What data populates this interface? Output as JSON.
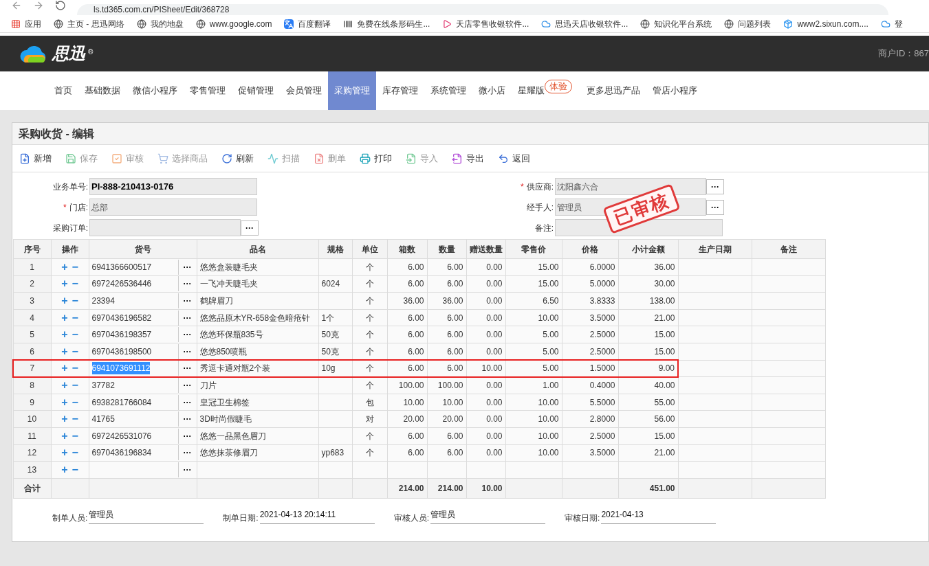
{
  "browser": {
    "url": "ls.td365.com.cn/PISheet/Edit/368728",
    "bookmarks": [
      {
        "label": "应用",
        "kind": "apps"
      },
      {
        "label": "主页 - 思迅网络",
        "kind": "globe"
      },
      {
        "label": "我的地盘",
        "kind": "globe"
      },
      {
        "label": "www.google.com",
        "kind": "globe"
      },
      {
        "label": "百度翻译",
        "kind": "translate"
      },
      {
        "label": "免费在线条形码生...",
        "kind": "barcode"
      },
      {
        "label": "天店零售收银软件...",
        "kind": "play"
      },
      {
        "label": "思迅天店收银软件...",
        "kind": "cloud"
      },
      {
        "label": "知识化平台系统",
        "kind": "globe"
      },
      {
        "label": "问题列表",
        "kind": "globe"
      },
      {
        "label": "www2.sixun.com....",
        "kind": "box"
      },
      {
        "label": "登",
        "kind": "cloud"
      }
    ]
  },
  "header": {
    "logo": "思迅",
    "logo_mark": "®",
    "merchant_id": "商户ID：867"
  },
  "nav": [
    {
      "label": "首页",
      "selected": false
    },
    {
      "label": "基础数据",
      "selected": false
    },
    {
      "label": "微信小程序",
      "selected": false
    },
    {
      "label": "零售管理",
      "selected": false
    },
    {
      "label": "促销管理",
      "selected": false
    },
    {
      "label": "会员管理",
      "selected": false
    },
    {
      "label": "采购管理",
      "selected": true
    },
    {
      "label": "库存管理",
      "selected": false
    },
    {
      "label": "系统管理",
      "selected": false
    },
    {
      "label": "微小店",
      "selected": false
    },
    {
      "label": "星耀版",
      "selected": false,
      "badge": "体验"
    },
    {
      "label": "更多思迅产品",
      "selected": false
    },
    {
      "label": "管店小程序",
      "selected": false
    }
  ],
  "panel_title": "采购收货 - 编辑",
  "toolbar": [
    {
      "label": "新增",
      "kind": "new",
      "disabled": false
    },
    {
      "label": "保存",
      "kind": "save",
      "disabled": true
    },
    {
      "label": "审核",
      "kind": "approve",
      "disabled": true
    },
    {
      "label": "选择商品",
      "kind": "cart",
      "disabled": true
    },
    {
      "label": "刷新",
      "kind": "refresh",
      "disabled": false
    },
    {
      "label": "扫描",
      "kind": "scan",
      "disabled": true
    },
    {
      "label": "删单",
      "kind": "delete",
      "disabled": true
    },
    {
      "label": "打印",
      "kind": "print",
      "disabled": false
    },
    {
      "label": "导入",
      "kind": "import",
      "disabled": true
    },
    {
      "label": "导出",
      "kind": "export",
      "disabled": false
    },
    {
      "label": "返回",
      "kind": "back",
      "disabled": false
    }
  ],
  "required_mark": "*",
  "form_left": [
    {
      "label": "业务单号:",
      "value": "PI-888-210413-0176",
      "required": false,
      "lookup": false,
      "bold": true
    },
    {
      "label": "门店:",
      "value": "总部",
      "required": true,
      "lookup": false,
      "bold": false
    },
    {
      "label": "采购订单:",
      "required": false,
      "lookup": true,
      "bold": false
    }
  ],
  "form_right": [
    {
      "label": "供应商:",
      "value": "沈阳鑫六合",
      "required": true,
      "lookup": true
    },
    {
      "label": "经手人:",
      "value": "管理员",
      "required": false,
      "lookup": true,
      "stamp": "已审核"
    },
    {
      "label": "备注:",
      "required": false,
      "lookup": false
    }
  ],
  "table": {
    "columns": [
      "序号",
      "操作",
      "货号",
      "品名",
      "规格",
      "单位",
      "箱数",
      "数量",
      "赠送数量",
      "零售价",
      "价格",
      "小计金额",
      "生产日期",
      "备注"
    ],
    "add_symbol": "+",
    "remove_symbol": "−",
    "lookup_symbol": "···",
    "rows": [
      {
        "no": "1",
        "code": "6941366600517",
        "name": "悠悠盒装睫毛夹",
        "unit": "个",
        "boxes": "6.00",
        "qty": "6.00",
        "gift": "0.00",
        "retail": "15.00",
        "price": "6.0000",
        "subtotal": "36.00",
        "selected": false
      },
      {
        "no": "2",
        "code": "6972426536446",
        "name": "一飞冲天睫毛夹",
        "spec": "6024",
        "unit": "个",
        "boxes": "6.00",
        "qty": "6.00",
        "gift": "0.00",
        "retail": "15.00",
        "price": "5.0000",
        "subtotal": "30.00",
        "selected": false
      },
      {
        "no": "3",
        "code": "23394",
        "name": "鹤牌眉刀",
        "unit": "个",
        "boxes": "36.00",
        "qty": "36.00",
        "gift": "0.00",
        "retail": "6.50",
        "price": "3.8333",
        "subtotal": "138.00",
        "selected": false
      },
      {
        "no": "4",
        "code": "6970436196582",
        "name": "悠悠品原木YR-658金色暗疮针",
        "spec": "1个",
        "unit": "个",
        "boxes": "6.00",
        "qty": "6.00",
        "gift": "0.00",
        "retail": "10.00",
        "price": "3.5000",
        "subtotal": "21.00",
        "selected": false
      },
      {
        "no": "5",
        "code": "6970436198357",
        "name": "悠悠环保瓶835号",
        "spec": "50克",
        "unit": "个",
        "boxes": "6.00",
        "qty": "6.00",
        "gift": "0.00",
        "retail": "5.00",
        "price": "2.5000",
        "subtotal": "15.00",
        "selected": false
      },
      {
        "no": "6",
        "code": "6970436198500",
        "name": "悠悠850喷瓶",
        "spec": "50克",
        "unit": "个",
        "boxes": "6.00",
        "qty": "6.00",
        "gift": "0.00",
        "retail": "5.00",
        "price": "2.5000",
        "subtotal": "15.00",
        "selected": false
      },
      {
        "no": "7",
        "code": "6941073691112",
        "name": "秀逗卡通对瓶2个装",
        "spec": "10g",
        "unit": "个",
        "boxes": "6.00",
        "qty": "6.00",
        "gift": "10.00",
        "retail": "5.00",
        "price": "1.5000",
        "subtotal": "9.00",
        "selected": true
      },
      {
        "no": "8",
        "code": "37782",
        "name": "刀片",
        "unit": "个",
        "boxes": "100.00",
        "qty": "100.00",
        "gift": "0.00",
        "retail": "1.00",
        "price": "0.4000",
        "subtotal": "40.00",
        "selected": false
      },
      {
        "no": "9",
        "code": "6938281766084",
        "name": "皇冠卫生棉签",
        "unit": "包",
        "boxes": "10.00",
        "qty": "10.00",
        "gift": "0.00",
        "retail": "10.00",
        "price": "5.5000",
        "subtotal": "55.00",
        "selected": false
      },
      {
        "no": "10",
        "code": "41765",
        "name": "3D时尚假睫毛",
        "unit": "对",
        "boxes": "20.00",
        "qty": "20.00",
        "gift": "0.00",
        "retail": "10.00",
        "price": "2.8000",
        "subtotal": "56.00",
        "selected": false
      },
      {
        "no": "11",
        "code": "6972426531076",
        "name": "悠悠一品黑色眉刀",
        "unit": "个",
        "boxes": "6.00",
        "qty": "6.00",
        "gift": "0.00",
        "retail": "10.00",
        "price": "2.5000",
        "subtotal": "15.00",
        "selected": false
      },
      {
        "no": "12",
        "code": "6970436196834",
        "name": "悠悠抹茶修眉刀",
        "spec": "yp683",
        "unit": "个",
        "boxes": "6.00",
        "qty": "6.00",
        "gift": "0.00",
        "retail": "10.00",
        "price": "3.5000",
        "subtotal": "21.00",
        "selected": false
      },
      {
        "no": "13",
        "selected": false
      }
    ],
    "total": {
      "label": "合计",
      "boxes": "214.00",
      "qty": "214.00",
      "gift": "10.00",
      "subtotal": "451.00"
    }
  },
  "footer": [
    {
      "label": "制单人员:",
      "value": "管理员"
    },
    {
      "label": "制单日期:",
      "value": "2021-04-13 20:14:11"
    },
    {
      "label": "审核人员:",
      "value": "管理员"
    },
    {
      "label": "审核日期:",
      "value": "2021-04-13"
    }
  ]
}
